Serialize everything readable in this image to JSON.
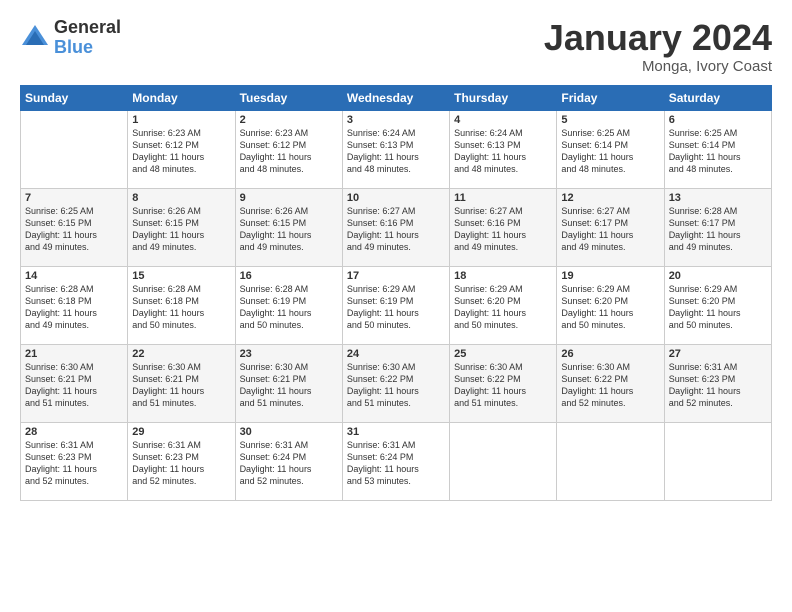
{
  "logo": {
    "general": "General",
    "blue": "Blue"
  },
  "title": "January 2024",
  "location": "Monga, Ivory Coast",
  "weekdays": [
    "Sunday",
    "Monday",
    "Tuesday",
    "Wednesday",
    "Thursday",
    "Friday",
    "Saturday"
  ],
  "weeks": [
    [
      {
        "day": "",
        "info": ""
      },
      {
        "day": "1",
        "info": "Sunrise: 6:23 AM\nSunset: 6:12 PM\nDaylight: 11 hours\nand 48 minutes."
      },
      {
        "day": "2",
        "info": "Sunrise: 6:23 AM\nSunset: 6:12 PM\nDaylight: 11 hours\nand 48 minutes."
      },
      {
        "day": "3",
        "info": "Sunrise: 6:24 AM\nSunset: 6:13 PM\nDaylight: 11 hours\nand 48 minutes."
      },
      {
        "day": "4",
        "info": "Sunrise: 6:24 AM\nSunset: 6:13 PM\nDaylight: 11 hours\nand 48 minutes."
      },
      {
        "day": "5",
        "info": "Sunrise: 6:25 AM\nSunset: 6:14 PM\nDaylight: 11 hours\nand 48 minutes."
      },
      {
        "day": "6",
        "info": "Sunrise: 6:25 AM\nSunset: 6:14 PM\nDaylight: 11 hours\nand 48 minutes."
      }
    ],
    [
      {
        "day": "7",
        "info": "Sunrise: 6:25 AM\nSunset: 6:15 PM\nDaylight: 11 hours\nand 49 minutes."
      },
      {
        "day": "8",
        "info": "Sunrise: 6:26 AM\nSunset: 6:15 PM\nDaylight: 11 hours\nand 49 minutes."
      },
      {
        "day": "9",
        "info": "Sunrise: 6:26 AM\nSunset: 6:15 PM\nDaylight: 11 hours\nand 49 minutes."
      },
      {
        "day": "10",
        "info": "Sunrise: 6:27 AM\nSunset: 6:16 PM\nDaylight: 11 hours\nand 49 minutes."
      },
      {
        "day": "11",
        "info": "Sunrise: 6:27 AM\nSunset: 6:16 PM\nDaylight: 11 hours\nand 49 minutes."
      },
      {
        "day": "12",
        "info": "Sunrise: 6:27 AM\nSunset: 6:17 PM\nDaylight: 11 hours\nand 49 minutes."
      },
      {
        "day": "13",
        "info": "Sunrise: 6:28 AM\nSunset: 6:17 PM\nDaylight: 11 hours\nand 49 minutes."
      }
    ],
    [
      {
        "day": "14",
        "info": "Sunrise: 6:28 AM\nSunset: 6:18 PM\nDaylight: 11 hours\nand 49 minutes."
      },
      {
        "day": "15",
        "info": "Sunrise: 6:28 AM\nSunset: 6:18 PM\nDaylight: 11 hours\nand 50 minutes."
      },
      {
        "day": "16",
        "info": "Sunrise: 6:28 AM\nSunset: 6:19 PM\nDaylight: 11 hours\nand 50 minutes."
      },
      {
        "day": "17",
        "info": "Sunrise: 6:29 AM\nSunset: 6:19 PM\nDaylight: 11 hours\nand 50 minutes."
      },
      {
        "day": "18",
        "info": "Sunrise: 6:29 AM\nSunset: 6:20 PM\nDaylight: 11 hours\nand 50 minutes."
      },
      {
        "day": "19",
        "info": "Sunrise: 6:29 AM\nSunset: 6:20 PM\nDaylight: 11 hours\nand 50 minutes."
      },
      {
        "day": "20",
        "info": "Sunrise: 6:29 AM\nSunset: 6:20 PM\nDaylight: 11 hours\nand 50 minutes."
      }
    ],
    [
      {
        "day": "21",
        "info": "Sunrise: 6:30 AM\nSunset: 6:21 PM\nDaylight: 11 hours\nand 51 minutes."
      },
      {
        "day": "22",
        "info": "Sunrise: 6:30 AM\nSunset: 6:21 PM\nDaylight: 11 hours\nand 51 minutes."
      },
      {
        "day": "23",
        "info": "Sunrise: 6:30 AM\nSunset: 6:21 PM\nDaylight: 11 hours\nand 51 minutes."
      },
      {
        "day": "24",
        "info": "Sunrise: 6:30 AM\nSunset: 6:22 PM\nDaylight: 11 hours\nand 51 minutes."
      },
      {
        "day": "25",
        "info": "Sunrise: 6:30 AM\nSunset: 6:22 PM\nDaylight: 11 hours\nand 51 minutes."
      },
      {
        "day": "26",
        "info": "Sunrise: 6:30 AM\nSunset: 6:22 PM\nDaylight: 11 hours\nand 52 minutes."
      },
      {
        "day": "27",
        "info": "Sunrise: 6:31 AM\nSunset: 6:23 PM\nDaylight: 11 hours\nand 52 minutes."
      }
    ],
    [
      {
        "day": "28",
        "info": "Sunrise: 6:31 AM\nSunset: 6:23 PM\nDaylight: 11 hours\nand 52 minutes."
      },
      {
        "day": "29",
        "info": "Sunrise: 6:31 AM\nSunset: 6:23 PM\nDaylight: 11 hours\nand 52 minutes."
      },
      {
        "day": "30",
        "info": "Sunrise: 6:31 AM\nSunset: 6:24 PM\nDaylight: 11 hours\nand 52 minutes."
      },
      {
        "day": "31",
        "info": "Sunrise: 6:31 AM\nSunset: 6:24 PM\nDaylight: 11 hours\nand 53 minutes."
      },
      {
        "day": "",
        "info": ""
      },
      {
        "day": "",
        "info": ""
      },
      {
        "day": "",
        "info": ""
      }
    ]
  ]
}
